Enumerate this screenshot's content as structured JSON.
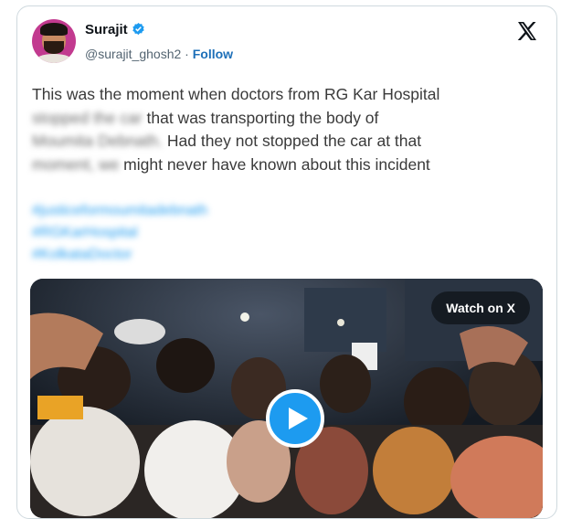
{
  "author": {
    "name": "Surajit",
    "handle": "@surajit_ghosh2",
    "separator": "·",
    "follow_label": "Follow",
    "verified": true
  },
  "platform_icon": "x-logo-icon",
  "post": {
    "line1": "This was the moment when doctors from RG Kar Hospital",
    "line2_blurred": "stopped the car",
    "line2_rest": " that was transporting the body of",
    "line3_blurred": "Moumita Debnath.",
    "line3_rest": " Had they not stopped the car at that",
    "line4_blurred": "moment, we",
    "line4_rest": " might never have known about this incident"
  },
  "hashtags": [
    "#justiceformoumitadebnath",
    "#RGKarHospital",
    "#KolkataDoctor"
  ],
  "media": {
    "watch_label": "Watch on X",
    "play_icon": "play-icon"
  },
  "colors": {
    "link": "#1d9bf0",
    "follow": "#1d6fb8",
    "verified": "#1d9bf0",
    "text": "#0f1419"
  }
}
